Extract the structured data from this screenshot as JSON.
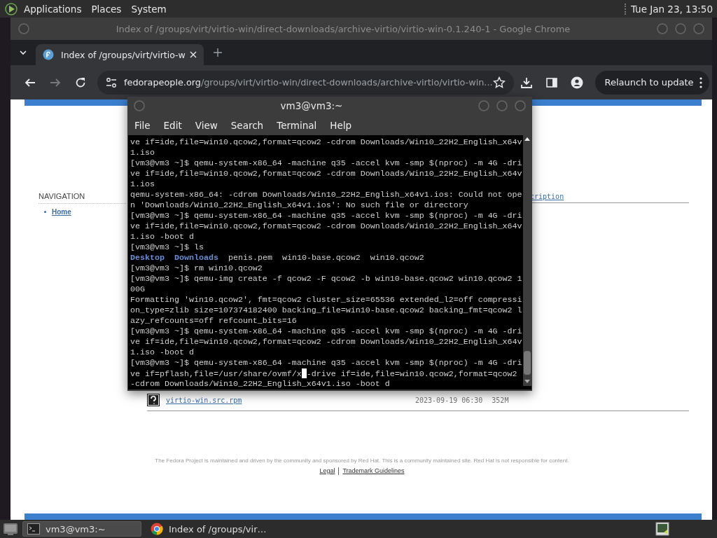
{
  "top_panel": {
    "menus": [
      "Applications",
      "Places",
      "System"
    ],
    "clock": "Tue Jan 23, 13:50"
  },
  "browser": {
    "title": "Index of /groups/virt/virtio-win/direct-downloads/archive-virtio/virtio-win-0.1.240-1 - Google Chrome",
    "tabs": [
      {
        "label": "Index of /groups/virt/virtio-w",
        "selected": true
      }
    ],
    "url": {
      "host": "fedorapeople.org",
      "path": "/groups/virt/virtio-win/direct-downloads/archive-virtio/virtio-win..."
    },
    "relaunch_button": "Relaunch to update",
    "page": {
      "nav_heading": "NAVIGATION",
      "nav_links": [
        "Home"
      ],
      "column_link": "cription",
      "files": [
        {
          "name": "virtio-win.src.rpm",
          "modified": "2023-09-19 06:30",
          "size": "352M"
        }
      ],
      "footer": "The Fedora Project is maintained and driven by the community and sponsored by Red Hat. This is a community maintained site. Red Hat is not responsible for content.",
      "footer_links": [
        "Legal",
        "Trademark Guidelines"
      ]
    }
  },
  "terminal": {
    "title": "vm3@vm3:~",
    "menus": [
      "File",
      "Edit",
      "View",
      "Search",
      "Terminal",
      "Help"
    ],
    "lines": [
      {
        "segments": [
          {
            "text": "ve if=ide,file=win10.qcow2,format=qcow2 -cdrom Downloads/Win10_22H2_English_x64v",
            "kind": "text"
          }
        ]
      },
      {
        "segments": [
          {
            "text": "1.iso",
            "kind": "text"
          }
        ]
      },
      {
        "segments": [
          {
            "text": "[vm3@vm3 ~]$ qemu-system-x86_64 -machine q35 -accel kvm -smp $(nproc) -m 4G -dri",
            "kind": "text"
          }
        ]
      },
      {
        "segments": [
          {
            "text": "ve if=ide,file=win10.qcow2,format=qcow2 -cdrom Downloads/Win10_22H2_English_x64v",
            "kind": "text"
          }
        ]
      },
      {
        "segments": [
          {
            "text": "1.ios",
            "kind": "text"
          }
        ]
      },
      {
        "segments": [
          {
            "text": "qemu-system-x86_64: -cdrom Downloads/Win10_22H2_English_x64v1.ios: Could not ope",
            "kind": "text"
          }
        ]
      },
      {
        "segments": [
          {
            "text": "n 'Downloads/Win10_22H2_English_x64v1.ios': No such file or directory",
            "kind": "text"
          }
        ]
      },
      {
        "segments": [
          {
            "text": "[vm3@vm3 ~]$ qemu-system-x86_64 -machine q35 -accel kvm -smp $(nproc) -m 4G -dri",
            "kind": "text"
          }
        ]
      },
      {
        "segments": [
          {
            "text": "ve if=ide,file=win10.qcow2,format=qcow2 -cdrom Downloads/Win10_22H2_English_x64v",
            "kind": "text"
          }
        ]
      },
      {
        "segments": [
          {
            "text": "1.iso -boot d",
            "kind": "text"
          }
        ]
      },
      {
        "segments": [
          {
            "text": "[vm3@vm3 ~]$ ls",
            "kind": "text"
          }
        ]
      },
      {
        "segments": [
          {
            "text": "Desktop",
            "kind": "directory"
          },
          {
            "text": "Downloads",
            "kind": "directory"
          },
          {
            "text": "penis.pem",
            "kind": "file"
          },
          {
            "text": "win10-base.qcow2",
            "kind": "file"
          },
          {
            "text": "win10.qcow2",
            "kind": "file"
          }
        ]
      },
      {
        "segments": [
          {
            "text": "[vm3@vm3 ~]$ rm win10.qcow2",
            "kind": "text"
          }
        ]
      },
      {
        "segments": [
          {
            "text": "[vm3@vm3 ~]$ qemu-img create -f qcow2 -F qcow2 -b win10-base.qcow2 win10.qcow2 1",
            "kind": "text"
          }
        ]
      },
      {
        "segments": [
          {
            "text": "00G",
            "kind": "text"
          }
        ]
      },
      {
        "segments": [
          {
            "text": "Formatting 'win10.qcow2', fmt=qcow2 cluster_size=65536 extended_l2=off compressi",
            "kind": "text"
          }
        ]
      },
      {
        "segments": [
          {
            "text": "on_type=zlib size=107374182400 backing_file=win10-base.qcow2 backing_fmt=qcow2 l",
            "kind": "text"
          }
        ]
      },
      {
        "segments": [
          {
            "text": "azy_refcounts=off refcount_bits=16",
            "kind": "text"
          }
        ]
      },
      {
        "segments": [
          {
            "text": "[vm3@vm3 ~]$ qemu-system-x86_64 -machine q35 -accel kvm -smp $(nproc) -m 4G -dri",
            "kind": "text"
          }
        ]
      },
      {
        "segments": [
          {
            "text": "ve if=ide,file=win10.qcow2,format=qcow2 -cdrom Downloads/Win10_22H2_English_x64v",
            "kind": "text"
          }
        ]
      },
      {
        "segments": [
          {
            "text": "1.iso -boot d",
            "kind": "text"
          }
        ]
      },
      {
        "segments": [
          {
            "text": "[vm3@vm3 ~]$ qemu-system-x86_64 -machine q35 -accel kvm -smp $(nproc) -m 4G -dri",
            "kind": "text"
          }
        ]
      },
      {
        "segments": [
          {
            "text": "ve if=pflash,file=/usr/share/ovmf/x",
            "kind": "text"
          },
          {
            "kind": "cursor"
          },
          {
            "text": "-drive if=ide,file=win10.qcow2,format=qcow2",
            "kind": "text"
          }
        ]
      },
      {
        "segments": [
          {
            "text": "-cdrom Downloads/Win10_22H2_English_x64v1.iso -boot d",
            "kind": "text"
          }
        ]
      }
    ]
  },
  "taskbar": {
    "tasks": [
      {
        "label": "vm3@vm3:~",
        "kind": "terminal",
        "selected": true
      },
      {
        "label": "Index of /groups/vir…",
        "kind": "browser",
        "selected": false
      }
    ]
  }
}
